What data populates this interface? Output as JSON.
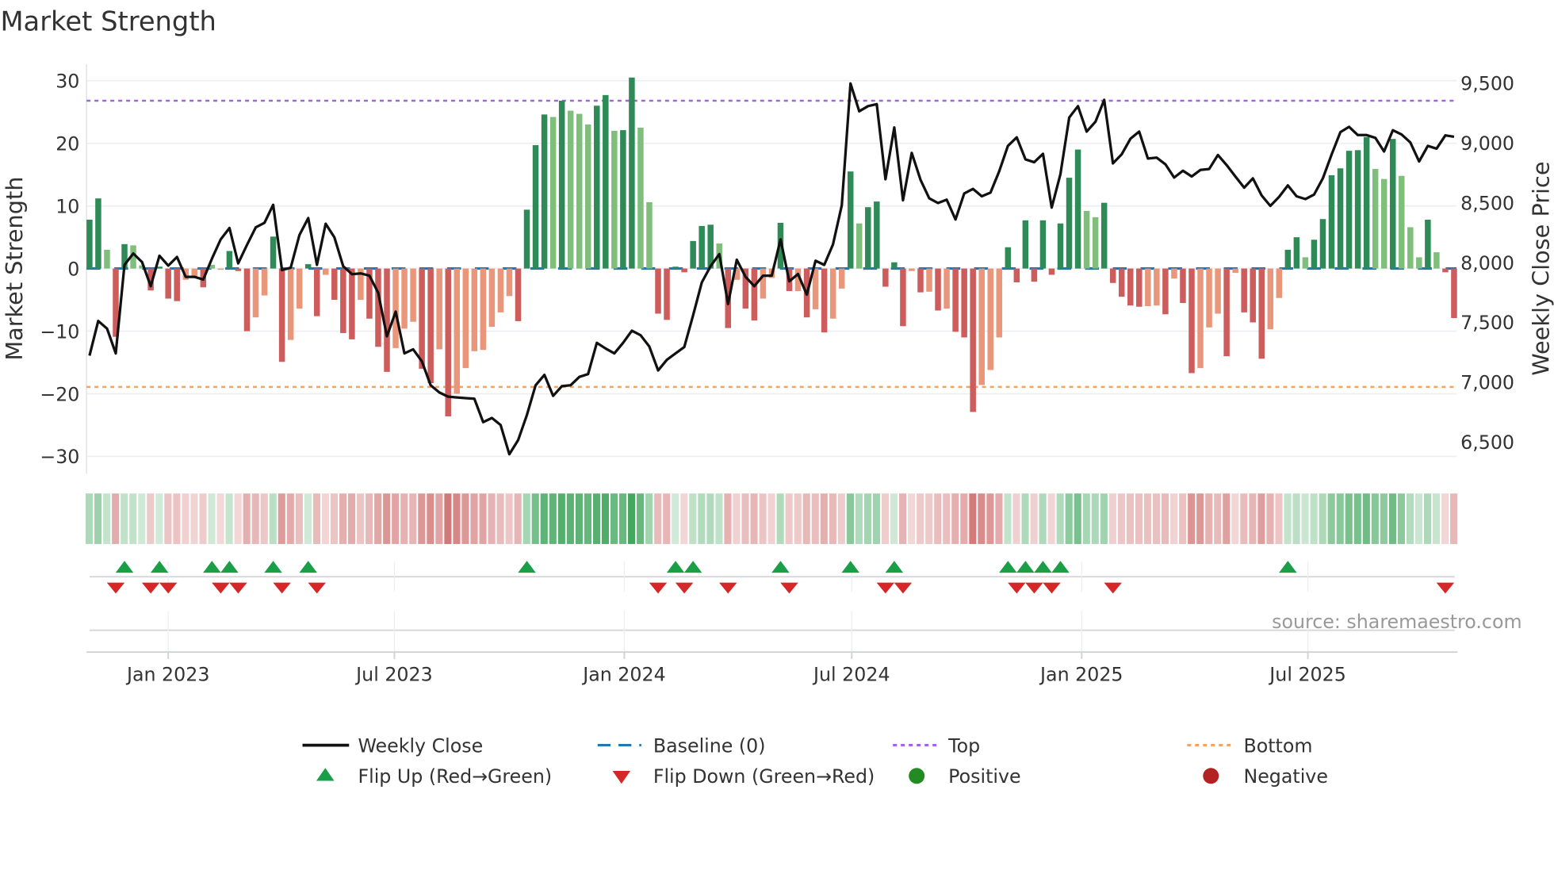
{
  "title": "Market Strength",
  "source": "source: sharemaestro.com",
  "legend": {
    "weekly_close": "Weekly Close",
    "baseline": "Baseline (0)",
    "top": "Top",
    "bottom": "Bottom",
    "flip_up": "Flip Up (Red→Green)",
    "flip_down": "Flip Down (Green→Red)",
    "positive": "Positive",
    "negative": "Negative"
  },
  "colors": {
    "G": "#2e8b57",
    "g": "#7fbf7b",
    "R": "#cd5c5c",
    "r": "#e9967a",
    "line": "#111111",
    "baseline": "#1f77b4",
    "top": "#a066e0",
    "bottom": "#f4a460",
    "flip_up": "#1a9e48",
    "flip_down": "#d62728",
    "positive": "#228b22",
    "negative": "#b22222"
  },
  "chart_data": {
    "type": "bar+line",
    "title": "Market Strength",
    "ylabel": "Market Strength",
    "y2label": "Weekly Close Price",
    "ylim": [
      -33,
      33
    ],
    "y2lim": [
      6250,
      9700
    ],
    "y_ticks": [
      "30",
      "20",
      "10",
      "0",
      "−10",
      "−20",
      "−30"
    ],
    "y_tick_values": [
      30,
      20,
      10,
      0,
      -10,
      -20,
      -30
    ],
    "y2_ticks": [
      "9,500",
      "9,000",
      "8,500",
      "8,000",
      "7,500",
      "7,000",
      "6,500"
    ],
    "y2_tick_values": [
      9500,
      9000,
      8500,
      8000,
      7500,
      7000,
      6500
    ],
    "x_ticks": [
      "Jan 2023",
      "Jul 2023",
      "Jan 2024",
      "Jul 2024",
      "Jan 2025",
      "Jul 2025"
    ],
    "x_tick_dates": [
      "2023-01-01",
      "2023-07-01",
      "2024-01-01",
      "2024-07-01",
      "2025-01-01",
      "2025-07-01"
    ],
    "start_date": "2022-10-30",
    "interval": "weekly",
    "top_level": 26.8,
    "bottom_level": -18.9,
    "baseline": 0,
    "strength": [
      7.8,
      11.2,
      3,
      -10.9,
      3.9,
      3.7,
      0.5,
      -3.5,
      0.3,
      -4.8,
      -5.2,
      -1.8,
      -1.2,
      -3,
      0.6,
      -0.2,
      2.8,
      -0.4,
      -10,
      -7.8,
      -4.3,
      5.1,
      -14.9,
      -11.4,
      -6.4,
      0.7,
      -7.6,
      -1,
      -5,
      -10.3,
      -11.3,
      -5,
      -8,
      -12.5,
      -16.5,
      -12.7,
      -9.6,
      -8.5,
      -16,
      -18.3,
      -12.9,
      -23.6,
      -20,
      -15.9,
      -13.2,
      -13,
      -9.3,
      -7,
      -4.4,
      -8.4,
      9.4,
      19.7,
      24.6,
      24.2,
      26.8,
      25.2,
      24.7,
      23,
      26,
      27.7,
      22,
      22.1,
      30.5,
      22.5,
      10.6,
      -7.2,
      -8.2,
      0.3,
      -0.6,
      4.4,
      6.8,
      7,
      4,
      -9.5,
      -1.8,
      -6.4,
      -8.3,
      -4.8,
      -1.5,
      7.3,
      -3.6,
      -3.6,
      -7.8,
      -6.5,
      -10.2,
      -8,
      -3.2,
      15.5,
      7.2,
      9.8,
      10.7,
      -2.9,
      1,
      -9.2,
      -0.4,
      -3.8,
      -3.7,
      -6.7,
      -6.4,
      -10.1,
      -11,
      -22.9,
      -18.6,
      -16.2,
      -11,
      3.4,
      -2.2,
      7.7,
      -2.1,
      7.7,
      -1,
      7.2,
      14.5,
      19,
      9.2,
      8.2,
      10.5,
      -2.3,
      -4.5,
      -5.9,
      -6.1,
      -6,
      -5.9,
      -7.3,
      -1.6,
      -5.5,
      -16.7,
      -15.9,
      -9.4,
      -7.2,
      -14,
      -0.7,
      -7,
      -8.6,
      -14.4,
      -9.7,
      -4.7,
      3,
      5,
      1.8,
      4.6,
      7.9,
      14.9,
      16,
      18.8,
      18.9,
      21,
      15.9,
      14.3,
      20.7,
      14.8,
      6.6,
      1.8,
      7.8,
      2.6,
      -0.6,
      -7.9
    ],
    "bar_types": "GGgRGggRGRRrrRgrGRRrrGRrrGRrRRRrRRRrrrRRrRrrrrrrrRGGGgGgggGGgGGggRRGRGGGgRrRRrrGRrRrRrrGgGGRGRrRrRrRRRrrrGRGRGRGGGggGRRRRrrRrRRrrrRrRRRrrGGgGGGGGGGggGgggGgRR",
    "weekly_close": [
      7222,
      7512,
      7448,
      7241,
      7981,
      8076,
      8005,
      7803,
      8057,
      7974,
      8047,
      7881,
      7881,
      7858,
      8033,
      8194,
      8289,
      7993,
      8147,
      8294,
      8332,
      8483,
      7938,
      7957,
      8230,
      8372,
      7981,
      8325,
      8211,
      7969,
      7903,
      7910,
      7891,
      7749,
      7384,
      7590,
      7241,
      7275,
      7175,
      6974,
      6914,
      6879,
      6872,
      6867,
      6862,
      6666,
      6701,
      6642,
      6398,
      6516,
      6725,
      6974,
      7061,
      6886,
      6967,
      6974,
      7045,
      7068,
      7329,
      7282,
      7241,
      7329,
      7431,
      7393,
      7298,
      7099,
      7187,
      7241,
      7294,
      7559,
      7834,
      7969,
      8071,
      7654,
      8024,
      7881,
      7803,
      7891,
      7891,
      8194,
      7843,
      7905,
      7732,
      8016,
      7981,
      8152,
      8479,
      9498,
      9265,
      9308,
      9325,
      8697,
      9130,
      8521,
      8917,
      8692,
      8538,
      8498,
      8526,
      8360,
      8578,
      8616,
      8554,
      8585,
      8763,
      8976,
      9047,
      8863,
      8839,
      8910,
      8460,
      8739,
      9213,
      9308,
      9095,
      9178,
      9360,
      8829,
      8905,
      9036,
      9095,
      8870,
      8877,
      8822,
      8711,
      8768,
      8720,
      8775,
      8782,
      8900,
      8815,
      8720,
      8626,
      8704,
      8562,
      8474,
      8550,
      8645,
      8554,
      8531,
      8569,
      8704,
      8905,
      9090,
      9135,
      9066,
      9066,
      9043,
      8929,
      9107,
      9071,
      9005,
      8846,
      8976,
      8953,
      9064,
      9052
    ],
    "flip_up_weeks": [
      5,
      9,
      15,
      17,
      22,
      26,
      51,
      68,
      70,
      80,
      88,
      93,
      106,
      108,
      110,
      112,
      138
    ],
    "flip_down_weeks": [
      4,
      8,
      10,
      16,
      18,
      23,
      27,
      66,
      69,
      74,
      81,
      92,
      94,
      107,
      109,
      111,
      118,
      156
    ],
    "legend_position": "bottom"
  }
}
